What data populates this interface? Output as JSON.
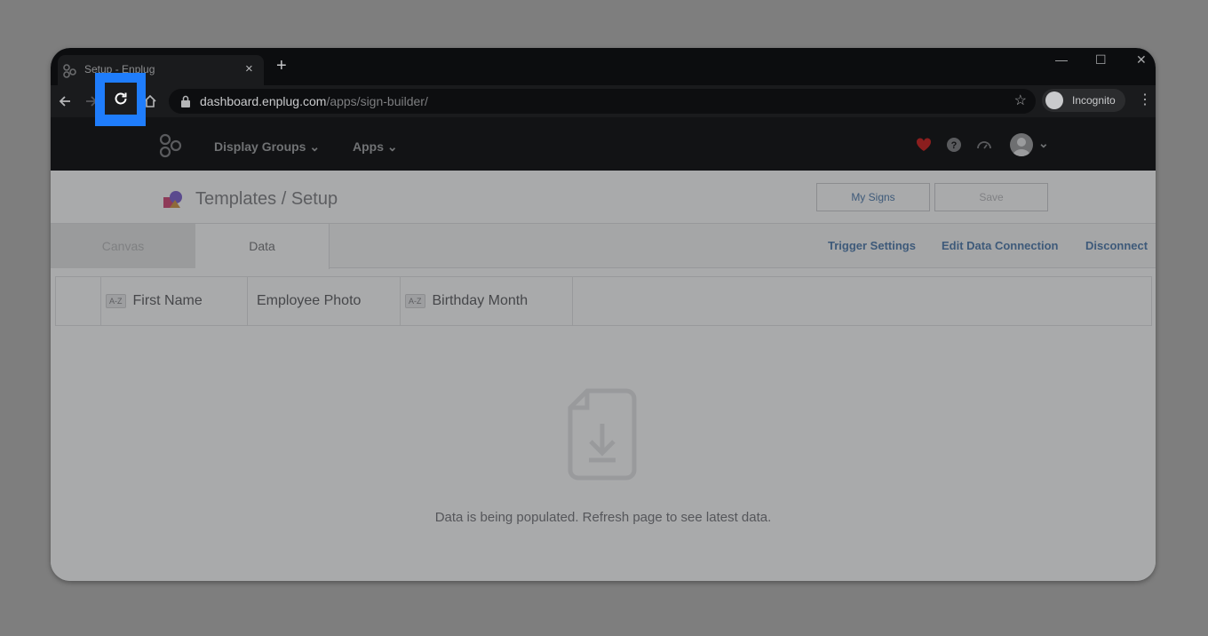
{
  "browser": {
    "tab_title": "Setup - Enplug",
    "tab_close": "×",
    "new_tab": "+",
    "window_controls": {
      "minimize": "—",
      "maximize": "☐",
      "close": "✕"
    },
    "url_domain": "dashboard.enplug.com",
    "url_path": "/apps/sign-builder/",
    "star": "☆",
    "profile_label": "Incognito",
    "menu": "⋮"
  },
  "app_header": {
    "nav": [
      {
        "label": "Display Groups ⌄"
      },
      {
        "label": "Apps ⌄"
      }
    ],
    "avatar_chevron": "⌄"
  },
  "page_header": {
    "title": "Templates / Setup",
    "my_signs_label": "My Signs",
    "save_label": "Save"
  },
  "tabs": {
    "canvas": "Canvas",
    "data": "Data"
  },
  "actions": {
    "trigger_settings": "Trigger Settings",
    "edit_data_connection": "Edit Data Connection",
    "disconnect": "Disconnect"
  },
  "grid": {
    "sort_badge": "A-Z",
    "columns": [
      {
        "label": "First Name"
      },
      {
        "label": "Employee Photo"
      },
      {
        "label": "Birthday Month"
      }
    ]
  },
  "empty_state": {
    "message": "Data is being populated. Refresh page to see latest data."
  },
  "colors": {
    "highlight": "#1f7dfc",
    "heart": "#8b1e1e",
    "link": "#3e5a7a"
  }
}
